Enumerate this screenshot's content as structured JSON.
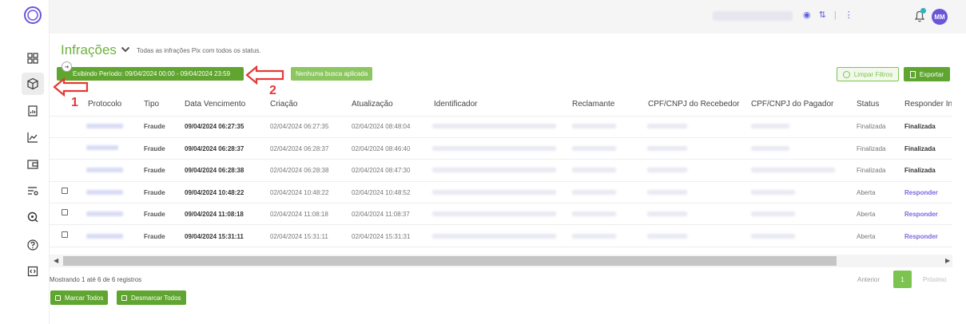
{
  "header": {
    "avatar_initials": "MM",
    "top_icons": [
      "eye-icon",
      "transfer-icon",
      "more-icon",
      "bell-icon"
    ]
  },
  "page": {
    "title": "Infrações",
    "subtitle": "Todas as infrações Pix com todos os status.",
    "period_label": "Exibindo Período: 09/04/2024 00:00 - 09/04/2024 23:59",
    "search_badge": "Nenhuma busca aplicada",
    "clear_filters": "Limpar Filtros",
    "export": "Exportar"
  },
  "annotations": {
    "label_1": "1",
    "label_2": "2"
  },
  "table": {
    "columns": [
      "Protocolo",
      "Tipo",
      "Data Vencimento",
      "Criação",
      "Atualização",
      "Identificador",
      "Reclamante",
      "CPF/CNPJ do Recebedor",
      "CPF/CNPJ do Pagador",
      "Status",
      "Responder Inf"
    ],
    "rows": [
      {
        "tipo": "Fraude",
        "vencimento": "09/04/2024 06:27:35",
        "criacao": "02/04/2024 06:27:35",
        "atualizacao": "02/04/2024 08:48:04",
        "status": "Finalizada",
        "responder": "Finalizada",
        "checkbox": false
      },
      {
        "tipo": "Fraude",
        "vencimento": "09/04/2024 06:28:37",
        "criacao": "02/04/2024 06:28:37",
        "atualizacao": "02/04/2024 08:46:40",
        "status": "Finalizada",
        "responder": "Finalizada",
        "checkbox": false
      },
      {
        "tipo": "Fraude",
        "vencimento": "09/04/2024 06:28:38",
        "criacao": "02/04/2024 06:28:38",
        "atualizacao": "02/04/2024 08:47:30",
        "status": "Finalizada",
        "responder": "Finalizada",
        "checkbox": false
      },
      {
        "tipo": "Fraude",
        "vencimento": "09/04/2024 10:48:22",
        "criacao": "02/04/2024 10:48:22",
        "atualizacao": "02/04/2024 10:48:52",
        "status": "Aberta",
        "responder": "Responder",
        "checkbox": true
      },
      {
        "tipo": "Fraude",
        "vencimento": "09/04/2024 11:08:18",
        "criacao": "02/04/2024 11:08:18",
        "atualizacao": "02/04/2024 11:08:37",
        "status": "Aberta",
        "responder": "Responder",
        "checkbox": true
      },
      {
        "tipo": "Fraude",
        "vencimento": "09/04/2024 15:31:11",
        "criacao": "02/04/2024 15:31:11",
        "atualizacao": "02/04/2024 15:31:31",
        "status": "Aberta",
        "responder": "Responder",
        "checkbox": true
      }
    ]
  },
  "footer": {
    "records": "Mostrando 1 até 6 de 6 registros",
    "prev": "Anterior",
    "page": "1",
    "next": "Próximo",
    "mark_all": "Marcar Todos",
    "unmark_all": "Desmarcar Todos"
  },
  "colors": {
    "brand_green": "#5fa530",
    "accent_purple": "#6b55d9",
    "annotation_red": "#e53935"
  }
}
